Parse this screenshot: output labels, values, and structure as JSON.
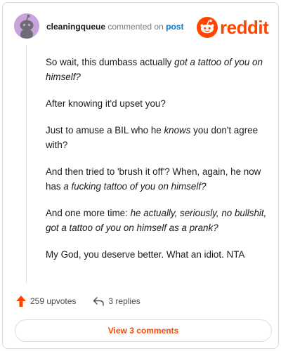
{
  "header": {
    "username": "cleaningqueue",
    "commented_text": "commented on",
    "post_link": "post",
    "brand": "reddit"
  },
  "comment": {
    "paragraphs": [
      {
        "segments": [
          {
            "text": "So wait, this dumbass actually ",
            "italic": false
          },
          {
            "text": "got a tattoo of you on himself?",
            "italic": true
          }
        ]
      },
      {
        "segments": [
          {
            "text": "After knowing it'd upset you?",
            "italic": false
          }
        ]
      },
      {
        "segments": [
          {
            "text": "Just to amuse a BIL who he ",
            "italic": false
          },
          {
            "text": "knows",
            "italic": true
          },
          {
            "text": " you don't agree with?",
            "italic": false
          }
        ]
      },
      {
        "segments": [
          {
            "text": "And then tried to 'brush it off'? When, again, he now has ",
            "italic": false
          },
          {
            "text": "a fucking tattoo of you on himself?",
            "italic": true
          }
        ]
      },
      {
        "segments": [
          {
            "text": "And one more time: ",
            "italic": false
          },
          {
            "text": "he actually, seriously, no bullshit, got a tattoo of you on himself as a prank?",
            "italic": true
          }
        ]
      },
      {
        "segments": [
          {
            "text": "My God, you deserve better. What an idiot. NTA",
            "italic": false
          }
        ]
      }
    ]
  },
  "actions": {
    "upvotes": "259 upvotes",
    "replies": "3 replies",
    "view_comments": "View 3 comments"
  },
  "colors": {
    "accent": "#ff4500",
    "link": "#0079d3",
    "avatar_bg": "#c9a3dc"
  },
  "icons": {
    "avatar": "snoo-avatar-icon",
    "logo": "reddit-snoo-icon",
    "upvote": "upvote-arrow-icon",
    "reply": "reply-arrow-icon"
  }
}
